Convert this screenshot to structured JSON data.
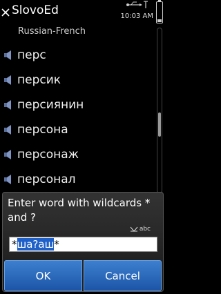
{
  "titlebar": {
    "title": "SlovoEd",
    "time": "10:03 AM"
  },
  "subtitle": "Russian-French",
  "list": {
    "items": [
      {
        "word": "перс"
      },
      {
        "word": "персик"
      },
      {
        "word": "персиянин"
      },
      {
        "word": "персона"
      },
      {
        "word": "персонаж"
      },
      {
        "word": "персонал"
      }
    ]
  },
  "dialog": {
    "title": "Enter word with wildcards * and ?",
    "indicator": "abc",
    "input": {
      "prefix": "*",
      "selected": "ша?аш",
      "suffix": "*"
    },
    "ok_label": "OK",
    "cancel_label": "Cancel"
  },
  "colors": {
    "accent": "#1e5fc8",
    "button": "#2e6bbf"
  }
}
